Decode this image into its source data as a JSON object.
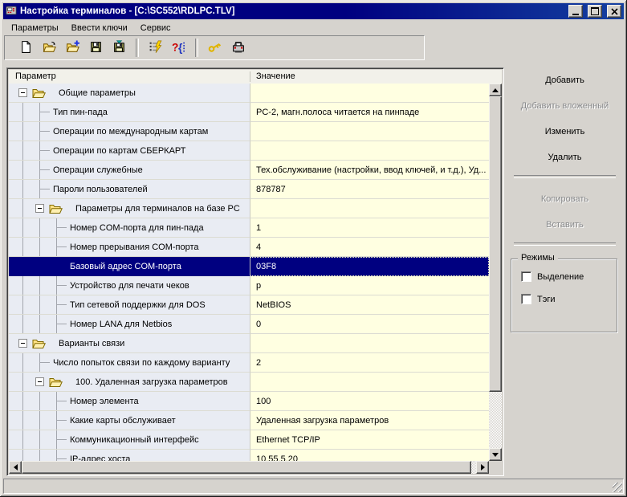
{
  "window": {
    "title": "Настройка терминалов - [C:\\SC552\\RDLPC.TLV]"
  },
  "menu": {
    "items": [
      "Параметры",
      "Ввести ключи",
      "Сервис"
    ]
  },
  "toolbar": {
    "buttons": [
      {
        "icon": "new-document"
      },
      {
        "icon": "open-file"
      },
      {
        "icon": "open-add"
      },
      {
        "icon": "save"
      },
      {
        "icon": "save-all"
      },
      {
        "icon": "separator"
      },
      {
        "icon": "validate-lightning"
      },
      {
        "icon": "help-syntax"
      },
      {
        "icon": "separator"
      },
      {
        "icon": "key"
      },
      {
        "icon": "terminal-printer"
      }
    ]
  },
  "table": {
    "columns": [
      "Параметр",
      "Значение"
    ],
    "rows": [
      {
        "level": 0,
        "type": "folder",
        "label": "Общие параметры",
        "value": ""
      },
      {
        "level": 1,
        "type": "leaf",
        "label": "Тип пин-пада",
        "value": "PC-2, магн.полоса читается на пинпаде"
      },
      {
        "level": 1,
        "type": "leaf",
        "label": "Операции по международным картам",
        "value": ""
      },
      {
        "level": 1,
        "type": "leaf",
        "label": "Операции по картам СБЕРКАРТ",
        "value": ""
      },
      {
        "level": 1,
        "type": "leaf",
        "label": "Операции служебные",
        "value": "Тех.обслуживание (настройки, ввод ключей, и т.д.), Уд..."
      },
      {
        "level": 1,
        "type": "leaf",
        "label": "Пароли пользователей",
        "value": "878787"
      },
      {
        "level": 1,
        "type": "folder",
        "label": "Параметры для терминалов на базе PC",
        "value": ""
      },
      {
        "level": 2,
        "type": "leaf",
        "label": "Номер COM-порта для пин-пада",
        "value": "1"
      },
      {
        "level": 2,
        "type": "leaf",
        "label": "Номер прерывания COM-порта",
        "value": "4"
      },
      {
        "level": 2,
        "type": "leaf",
        "label": "Базовый адрес COM-порта",
        "value": "03F8",
        "selected": true
      },
      {
        "level": 2,
        "type": "leaf",
        "label": "Устройство для печати чеков",
        "value": "p"
      },
      {
        "level": 2,
        "type": "leaf",
        "label": "Тип сетевой поддержки для DOS",
        "value": "NetBIOS"
      },
      {
        "level": 2,
        "type": "leaf",
        "label": "Номер LANA для Netbios",
        "value": "0"
      },
      {
        "level": 0,
        "type": "folder",
        "label": "Варианты связи",
        "value": ""
      },
      {
        "level": 1,
        "type": "leaf",
        "label": "Число попыток связи по каждому варианту",
        "value": "2"
      },
      {
        "level": 1,
        "type": "folder",
        "label": "100. Удаленная загрузка параметров",
        "value": ""
      },
      {
        "level": 2,
        "type": "leaf",
        "label": "Номер элемента",
        "value": "100"
      },
      {
        "level": 2,
        "type": "leaf",
        "label": "Какие карты обслуживает",
        "value": "Удаленная загрузка параметров"
      },
      {
        "level": 2,
        "type": "leaf",
        "label": "Коммуникационный интерфейс",
        "value": "Ethernet TCP/IP"
      },
      {
        "level": 2,
        "type": "leaf",
        "label": "IP-адрес хоста",
        "value": "10.55.5.20"
      }
    ]
  },
  "side_panel": {
    "buttons": [
      {
        "label": "Добавить",
        "enabled": true
      },
      {
        "label": "Добавить вложенный",
        "enabled": false
      },
      {
        "label": "Изменить",
        "enabled": true
      },
      {
        "label": "Удалить",
        "enabled": true
      },
      {
        "separator": true
      },
      {
        "label": "Копировать",
        "enabled": false
      },
      {
        "label": "Вставить",
        "enabled": false
      },
      {
        "separator": true
      }
    ],
    "modes": {
      "title": "Режимы",
      "options": [
        {
          "label": "Выделение",
          "checked": false
        },
        {
          "label": "Тэги",
          "checked": false
        }
      ]
    }
  },
  "status_bar": {
    "text": ""
  },
  "colors": {
    "titlebar": "#000080",
    "selection": "#000080",
    "param_column_bg": "#e9ecf3",
    "value_column_bg": "#ffffe1"
  }
}
